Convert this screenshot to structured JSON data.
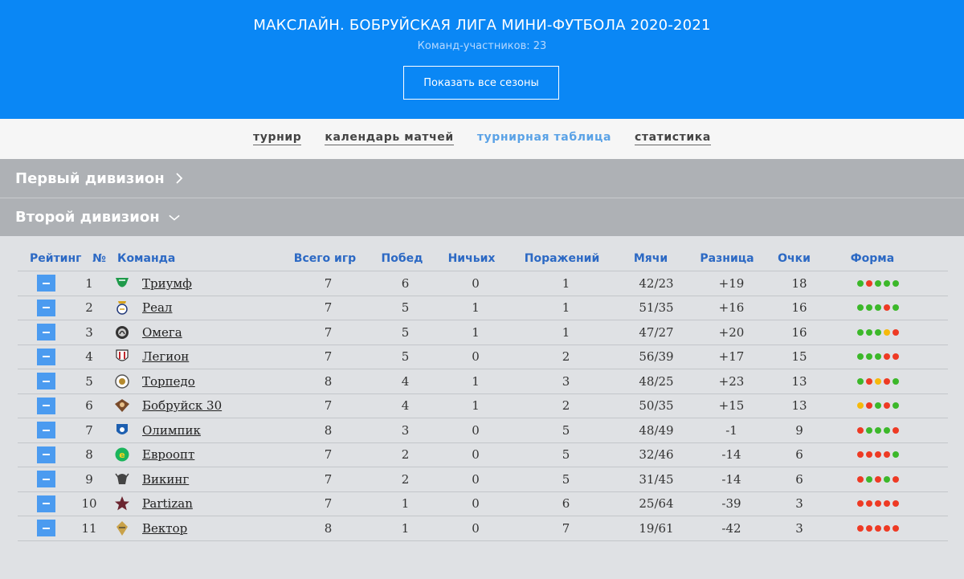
{
  "header": {
    "title": "МАКСЛАЙН. БОБРУЙСКАЯ ЛИГА МИНИ-ФУТБОЛА 2020-2021",
    "subtitle": "Команд-участников: 23",
    "seasons_button": "Показать все сезоны"
  },
  "nav": [
    {
      "label": "турнир",
      "active": false
    },
    {
      "label": "календарь матчей",
      "active": false
    },
    {
      "label": "турнирная таблица",
      "active": true
    },
    {
      "label": "статистика",
      "active": false
    }
  ],
  "divisions": [
    {
      "name": "Первый дивизион",
      "icon": "chevron-right-icon",
      "expanded": false
    },
    {
      "name": "Второй дивизион",
      "icon": "chevron-down-icon",
      "expanded": true
    }
  ],
  "table": {
    "columns": {
      "rating": "Рейтинг",
      "num": "№",
      "team": "Команда",
      "games": "Всего игр",
      "wins": "Побед",
      "draws": "Ничьих",
      "losses": "Поражений",
      "goals": "Мячи",
      "diff": "Разница",
      "points": "Очки",
      "form": "Форма"
    },
    "rows": [
      {
        "num": "1",
        "team": "Триумф",
        "logo": "triumf-logo-icon",
        "games": "7",
        "wins": "6",
        "draws": "0",
        "losses": "1",
        "goals": "42/23",
        "diff": "+19",
        "points": "18",
        "form": [
          "W",
          "L",
          "W",
          "W",
          "W"
        ]
      },
      {
        "num": "2",
        "team": "Реал",
        "logo": "real-logo-icon",
        "games": "7",
        "wins": "5",
        "draws": "1",
        "losses": "1",
        "goals": "51/35",
        "diff": "+16",
        "points": "16",
        "form": [
          "W",
          "W",
          "W",
          "L",
          "W"
        ]
      },
      {
        "num": "3",
        "team": "Омега",
        "logo": "omega-logo-icon",
        "games": "7",
        "wins": "5",
        "draws": "1",
        "losses": "1",
        "goals": "47/27",
        "diff": "+20",
        "points": "16",
        "form": [
          "W",
          "W",
          "W",
          "D",
          "L"
        ]
      },
      {
        "num": "4",
        "team": "Легион",
        "logo": "legion-logo-icon",
        "games": "7",
        "wins": "5",
        "draws": "0",
        "losses": "2",
        "goals": "56/39",
        "diff": "+17",
        "points": "15",
        "form": [
          "W",
          "W",
          "W",
          "L",
          "L"
        ]
      },
      {
        "num": "5",
        "team": "Торпедо",
        "logo": "torpedo-logo-icon",
        "games": "8",
        "wins": "4",
        "draws": "1",
        "losses": "3",
        "goals": "48/25",
        "diff": "+23",
        "points": "13",
        "form": [
          "W",
          "L",
          "D",
          "L",
          "W"
        ]
      },
      {
        "num": "6",
        "team": "Бобруйск 30",
        "logo": "bobruisk30-logo-icon",
        "games": "7",
        "wins": "4",
        "draws": "1",
        "losses": "2",
        "goals": "50/35",
        "diff": "+15",
        "points": "13",
        "form": [
          "D",
          "L",
          "W",
          "L",
          "W"
        ]
      },
      {
        "num": "7",
        "team": "Олимпик",
        "logo": "olimpik-logo-icon",
        "games": "8",
        "wins": "3",
        "draws": "0",
        "losses": "5",
        "goals": "48/49",
        "diff": "-1",
        "points": "9",
        "form": [
          "L",
          "W",
          "W",
          "W",
          "L"
        ]
      },
      {
        "num": "8",
        "team": "Евроопт",
        "logo": "evroopt-logo-icon",
        "games": "7",
        "wins": "2",
        "draws": "0",
        "losses": "5",
        "goals": "32/46",
        "diff": "-14",
        "points": "6",
        "form": [
          "L",
          "L",
          "L",
          "L",
          "W"
        ]
      },
      {
        "num": "9",
        "team": "Викинг",
        "logo": "viking-logo-icon",
        "games": "7",
        "wins": "2",
        "draws": "0",
        "losses": "5",
        "goals": "31/45",
        "diff": "-14",
        "points": "6",
        "form": [
          "L",
          "W",
          "L",
          "W",
          "L"
        ]
      },
      {
        "num": "10",
        "team": "Partizan",
        "logo": "partizan-logo-icon",
        "games": "7",
        "wins": "1",
        "draws": "0",
        "losses": "6",
        "goals": "25/64",
        "diff": "-39",
        "points": "3",
        "form": [
          "L",
          "L",
          "L",
          "L",
          "L"
        ]
      },
      {
        "num": "11",
        "team": "Вектор",
        "logo": "vektor-logo-icon",
        "games": "8",
        "wins": "1",
        "draws": "0",
        "losses": "7",
        "goals": "19/61",
        "diff": "-42",
        "points": "3",
        "form": [
          "L",
          "L",
          "L",
          "L",
          "L"
        ]
      }
    ]
  },
  "colors": {
    "header_bg": "#0a87f5",
    "active_nav": "#5aa2e6",
    "division_bg": "#aeb1b5",
    "table_header": "#2c69c4",
    "rating_button": "#4b9bf0",
    "form_win": "#3cb82a",
    "form_loss": "#ee3a24",
    "form_draw": "#f6b90b"
  }
}
